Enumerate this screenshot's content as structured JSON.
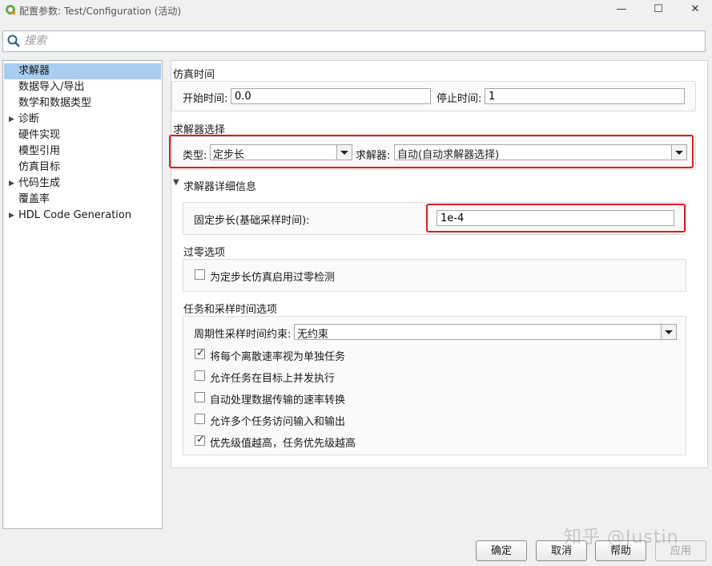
{
  "window": {
    "title": "配置参数: Test/Configuration (活动)",
    "minimize_glyph": "—",
    "maximize_glyph": "☐",
    "close_glyph": "✕"
  },
  "search": {
    "placeholder": "搜索"
  },
  "sidebar": {
    "items": [
      {
        "label": "求解器",
        "selected": true,
        "expandable": false
      },
      {
        "label": "数据导入/导出",
        "expandable": false
      },
      {
        "label": "数学和数据类型",
        "expandable": false
      },
      {
        "label": "诊断",
        "expandable": true
      },
      {
        "label": "硬件实现",
        "expandable": false
      },
      {
        "label": "模型引用",
        "expandable": false
      },
      {
        "label": "仿真目标",
        "expandable": false
      },
      {
        "label": "代码生成",
        "expandable": true
      },
      {
        "label": "覆盖率",
        "expandable": false
      },
      {
        "label": "HDL Code Generation",
        "expandable": true
      }
    ]
  },
  "sim_time": {
    "header": "仿真时间",
    "start_label": "开始时间:",
    "start_value": "0.0",
    "stop_label": "停止时间:",
    "stop_value": "1"
  },
  "solver_select": {
    "header": "求解器选择",
    "type_label": "类型:",
    "type_value": "定步长",
    "solver_label": "求解器:",
    "solver_value": "自动(自动求解器选择)"
  },
  "solver_details": {
    "header": "求解器详细信息",
    "fixed_step_label": "固定步长(基础采样时间):",
    "fixed_step_value": "1e-4"
  },
  "zero_crossing": {
    "header": "过零选项",
    "enable_label": "为定步长仿真启用过零检测",
    "enable_checked": false
  },
  "tasking": {
    "header": "任务和采样时间选项",
    "periodic_label": "周期性采样时间约束:",
    "periodic_value": "无约束",
    "options": [
      {
        "label": "将每个离散速率视为单独任务",
        "checked": true
      },
      {
        "label": "允许任务在目标上并发执行",
        "checked": false
      },
      {
        "label": "自动处理数据传输的速率转换",
        "checked": false
      },
      {
        "label": "允许多个任务访问输入和输出",
        "checked": false
      },
      {
        "label": "优先级值越高，任务优先级越高",
        "checked": true
      }
    ]
  },
  "buttons": {
    "ok": "确定",
    "cancel": "取消",
    "help": "帮助",
    "apply": "应用"
  },
  "watermark": "知乎 @Justin",
  "colors": {
    "highlight": "#d62020",
    "selection": "#a8cdf0"
  }
}
